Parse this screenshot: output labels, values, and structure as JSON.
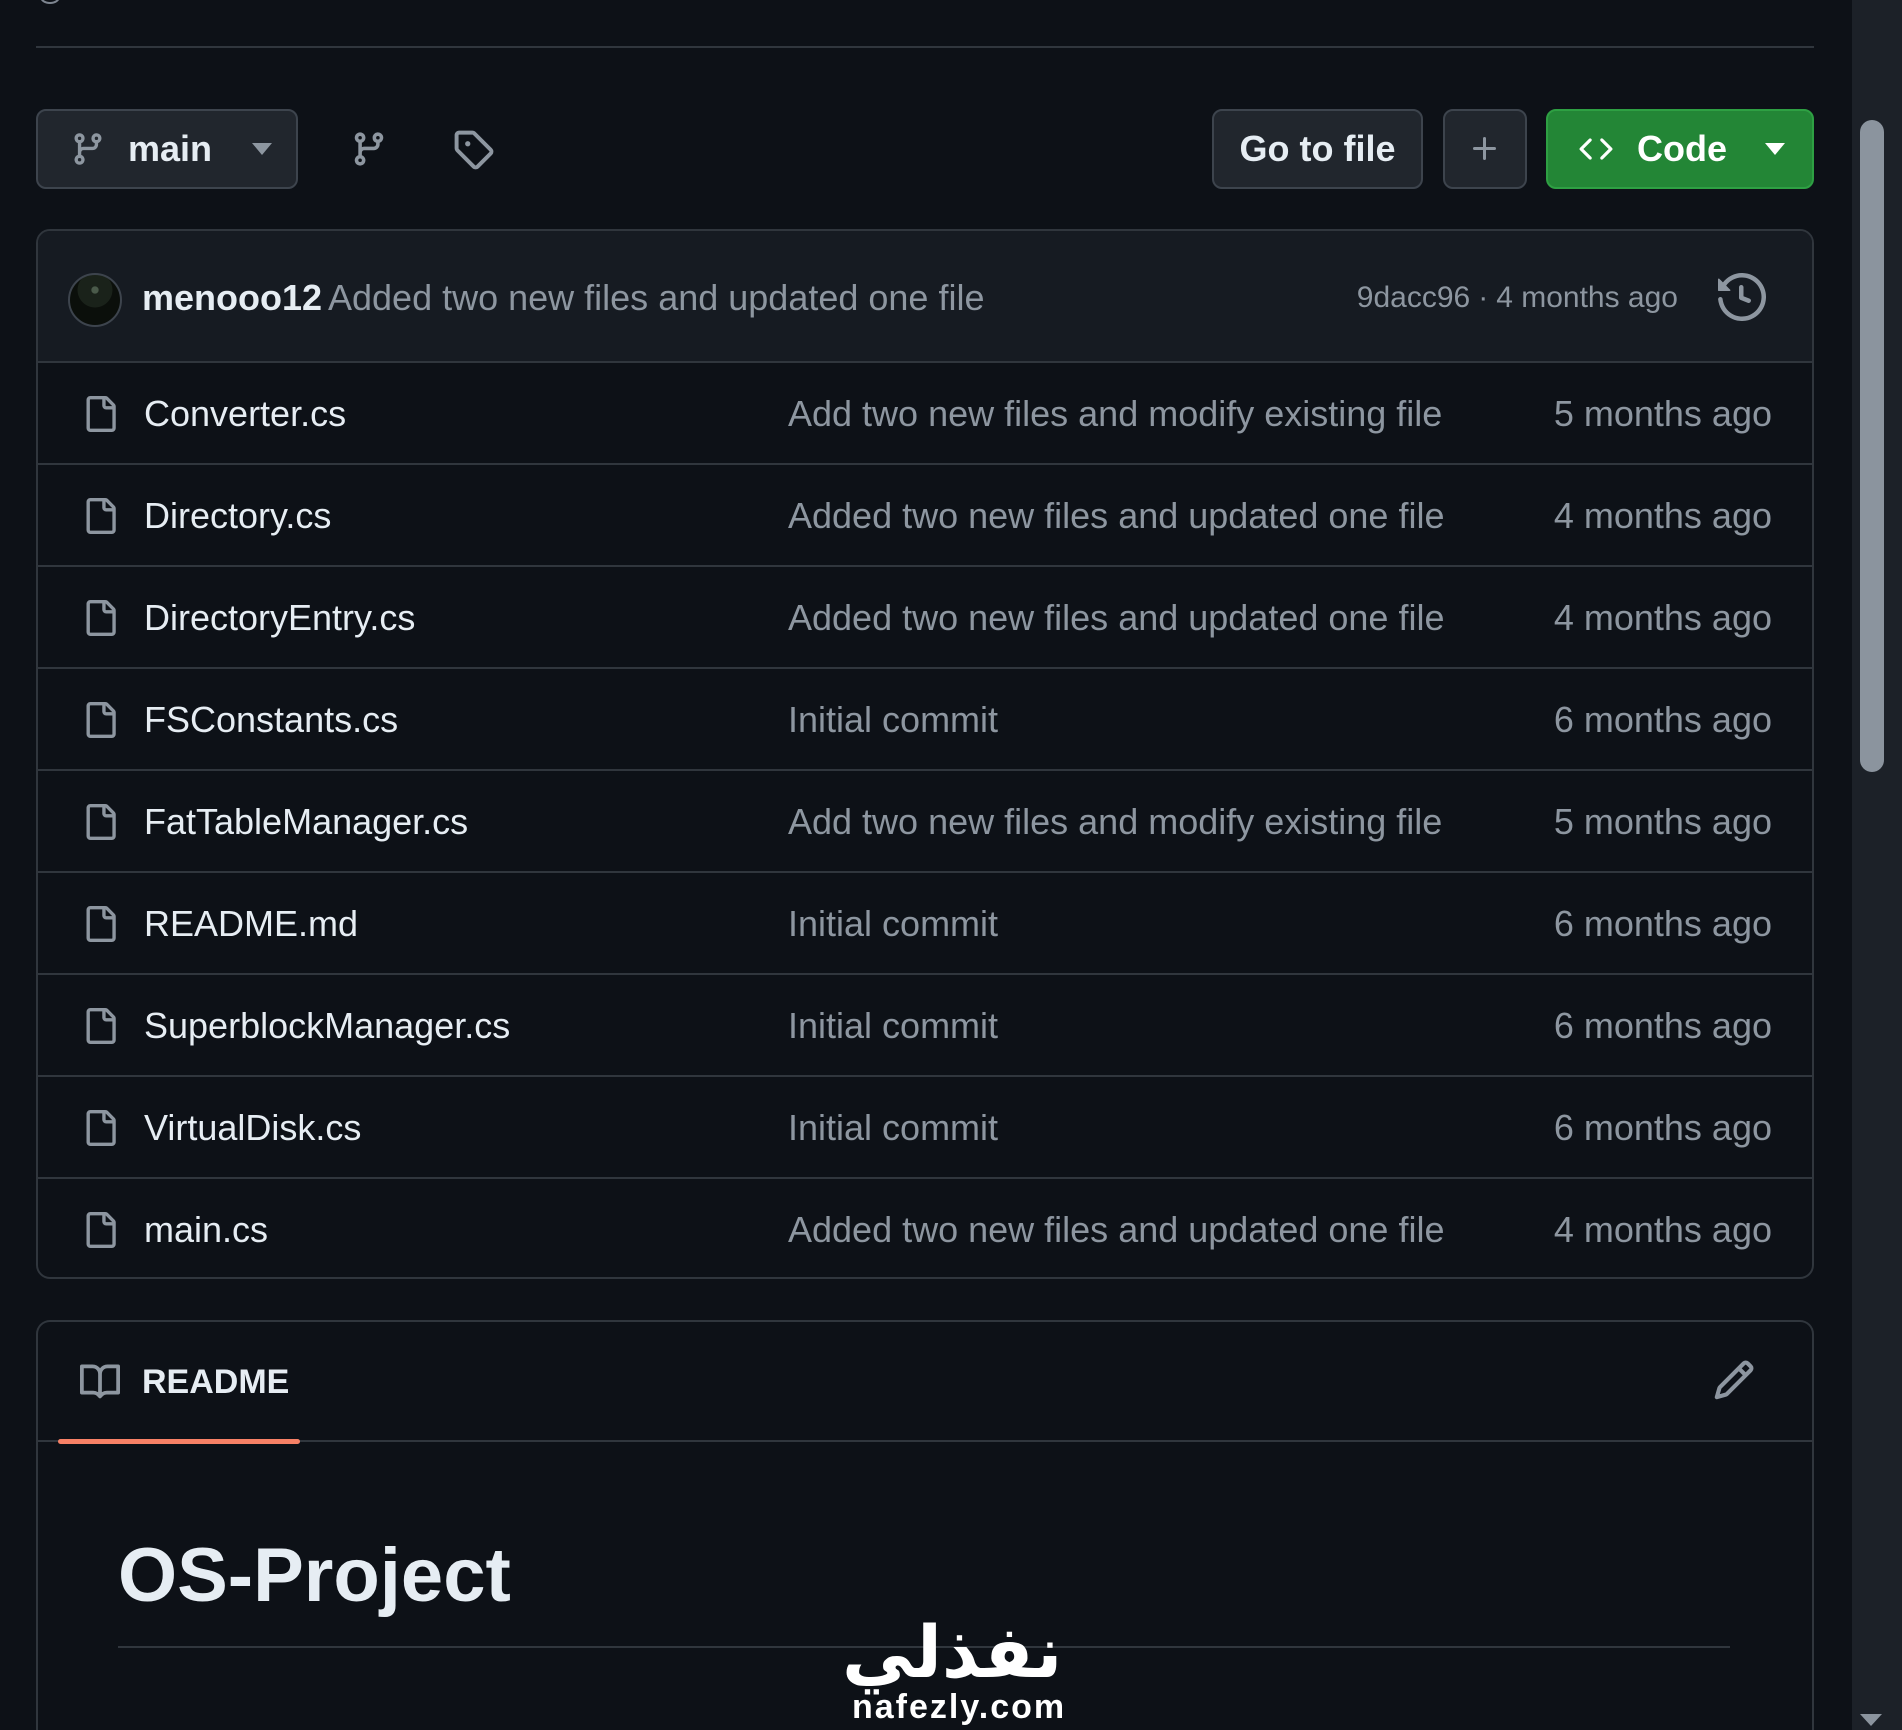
{
  "toolbar": {
    "branch_label": "main",
    "goto_file_label": "Go to file",
    "add_file_label": "+",
    "code_label": "Code"
  },
  "latest_commit": {
    "author": "menooo12",
    "message": "Added two new files and updated one file",
    "hash": "9dacc96",
    "separator": "·",
    "age": "4 months ago"
  },
  "files": [
    {
      "name": "Converter.cs",
      "message": "Add two new files and modify existing file",
      "age": "5 months ago"
    },
    {
      "name": "Directory.cs",
      "message": "Added two new files and updated one file",
      "age": "4 months ago"
    },
    {
      "name": "DirectoryEntry.cs",
      "message": "Added two new files and updated one file",
      "age": "4 months ago"
    },
    {
      "name": "FSConstants.cs",
      "message": "Initial commit",
      "age": "6 months ago"
    },
    {
      "name": "FatTableManager.cs",
      "message": "Add two new files and modify existing file",
      "age": "5 months ago"
    },
    {
      "name": "README.md",
      "message": "Initial commit",
      "age": "6 months ago"
    },
    {
      "name": "SuperblockManager.cs",
      "message": "Initial commit",
      "age": "6 months ago"
    },
    {
      "name": "VirtualDisk.cs",
      "message": "Initial commit",
      "age": "6 months ago"
    },
    {
      "name": "main.cs",
      "message": "Added two new files and updated one file",
      "age": "4 months ago"
    }
  ],
  "readme": {
    "tab_label": "README",
    "title": "OS-Project"
  },
  "watermark": {
    "arabic": "نفذلي",
    "domain": "nafezly.com"
  },
  "colors": {
    "background": "#0d1117",
    "border": "#30363d",
    "muted_text": "#8d96a0",
    "code_button": "#238636",
    "readme_tab_accent": "#f78166"
  },
  "icons": {
    "branch": "git-branch-icon",
    "tag": "tag-icon",
    "file": "file-icon",
    "history": "history-icon",
    "book": "book-icon",
    "edit": "pencil-icon",
    "code": "code-icon"
  }
}
